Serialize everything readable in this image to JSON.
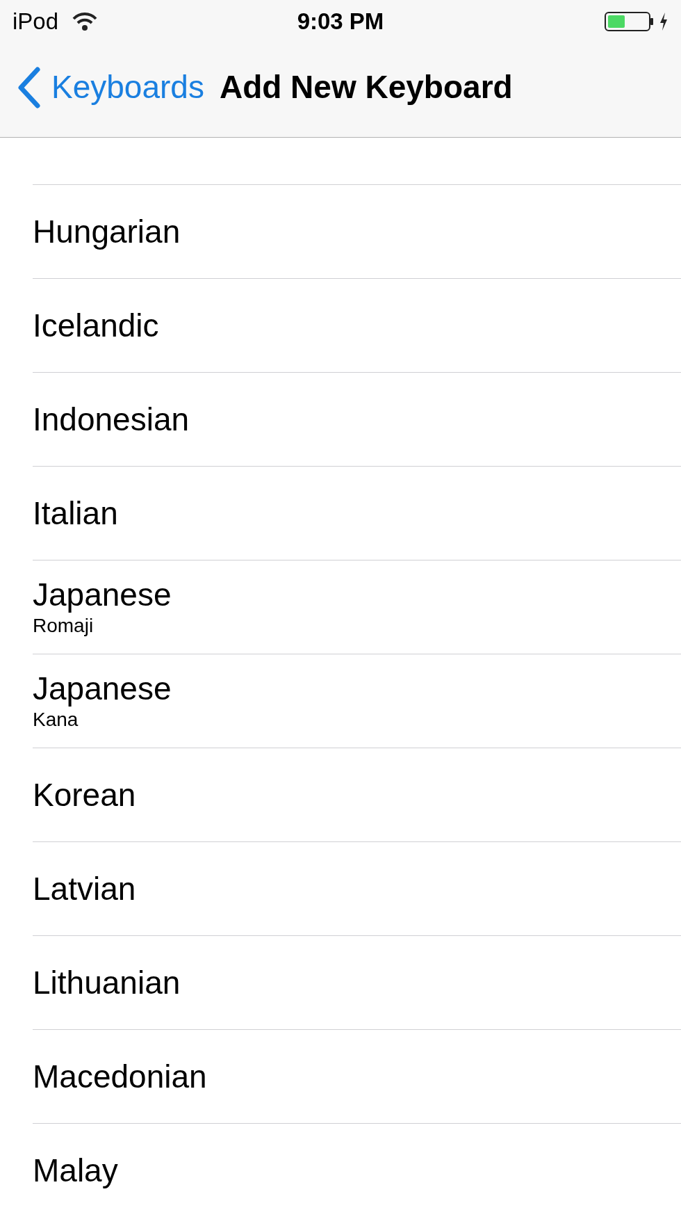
{
  "status_bar": {
    "carrier": "iPod",
    "time": "9:03 PM",
    "charging": true
  },
  "nav_bar": {
    "back": "Keyboards",
    "title": "Add New Keyboard"
  },
  "items": [
    {
      "name": "Hungarian"
    },
    {
      "name": "Icelandic"
    },
    {
      "name": "Indonesian"
    },
    {
      "name": "Italian"
    },
    {
      "name": "Japanese",
      "subtitle": "Romaji"
    },
    {
      "name": "Japanese",
      "subtitle": "Kana"
    },
    {
      "name": "Korean"
    },
    {
      "name": "Latvian"
    },
    {
      "name": "Lithuanian"
    },
    {
      "name": "Macedonian"
    },
    {
      "name": "Malay"
    }
  ]
}
